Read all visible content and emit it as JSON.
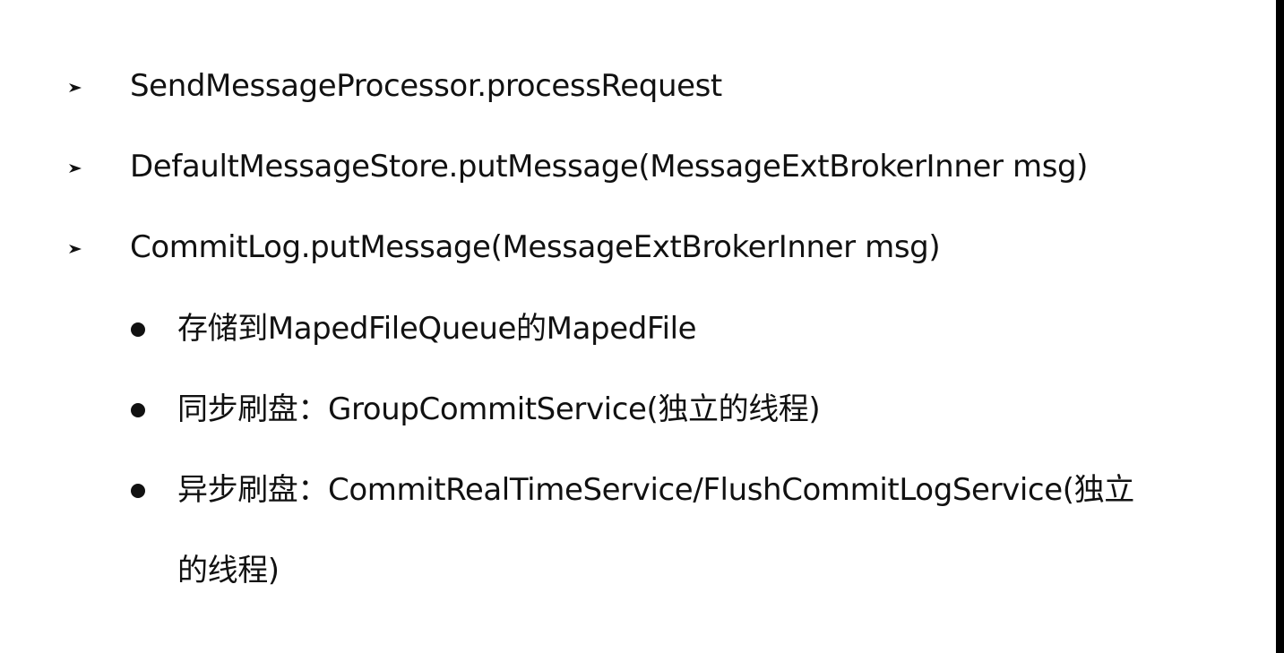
{
  "slide": {
    "items": [
      {
        "level": 1,
        "marker": "arrow-bullet-icon",
        "text": "SendMessageProcessor.processRequest"
      },
      {
        "level": 1,
        "marker": "arrow-bullet-icon",
        "text": "DefaultMessageStore.putMessage(MessageExtBrokerInner msg)"
      },
      {
        "level": 1,
        "marker": "arrow-bullet-icon",
        "text": "CommitLog.putMessage(MessageExtBrokerInner msg)"
      },
      {
        "level": 2,
        "marker": "dot-bullet-icon",
        "text": "存储到MapedFileQueue的MapedFile"
      },
      {
        "level": 2,
        "marker": "dot-bullet-icon",
        "text": "同步刷盘：GroupCommitService(独立的线程)"
      },
      {
        "level": 2,
        "marker": "dot-bullet-icon",
        "text": "异步刷盘：CommitRealTimeService/FlushCommitLogService(独立",
        "continuation": "的线程)"
      }
    ]
  }
}
